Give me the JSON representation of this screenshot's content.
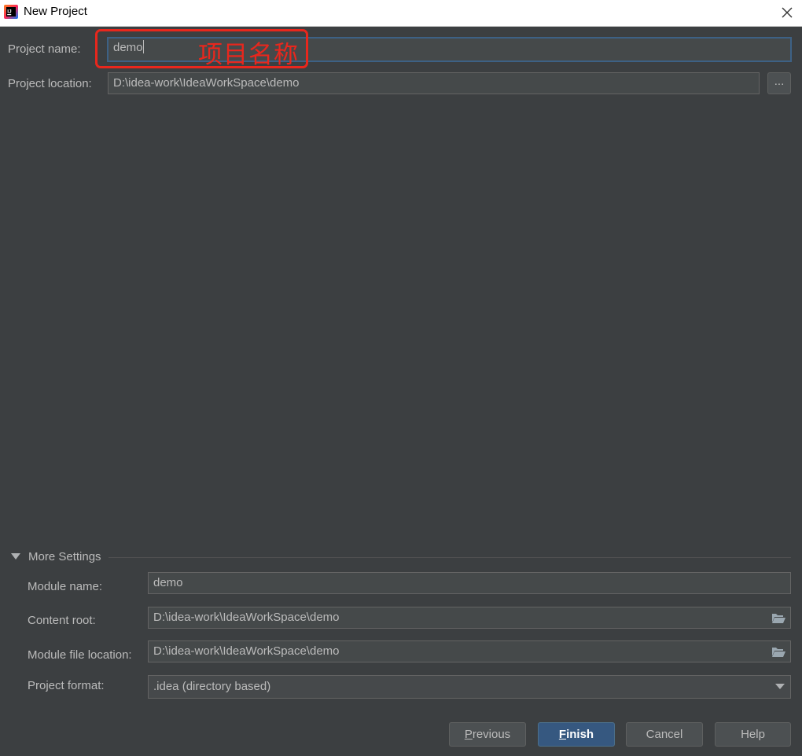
{
  "window": {
    "title": "New Project",
    "close_symbol": "✕"
  },
  "annotation": {
    "text": "项目名称"
  },
  "project": {
    "name_label": "Project name:",
    "name_value": "demo",
    "location_label": "Project location:",
    "location_value": "D:\\idea-work\\IdeaWorkSpace\\demo",
    "browse_label": "..."
  },
  "more_settings": {
    "label": "More Settings",
    "expanded": true,
    "module_name_label": "Module name:",
    "module_name_value": "demo",
    "content_root_label": "Content root:",
    "content_root_value": "D:\\idea-work\\IdeaWorkSpace\\demo",
    "module_file_label": "Module file location:",
    "module_file_value": "D:\\idea-work\\IdeaWorkSpace\\demo",
    "format_label": "Project format:",
    "format_value": ".idea (directory based)"
  },
  "buttons": {
    "previous_mnemonic": "P",
    "previous_rest": "revious",
    "finish_mnemonic": "F",
    "finish_rest": "inish",
    "cancel": "Cancel",
    "help": "Help"
  },
  "colors": {
    "background": "#3c3f41",
    "field": "#45494a",
    "focus_border": "#3d6185",
    "primary_button": "#365880",
    "annotation": "#e8271d"
  }
}
